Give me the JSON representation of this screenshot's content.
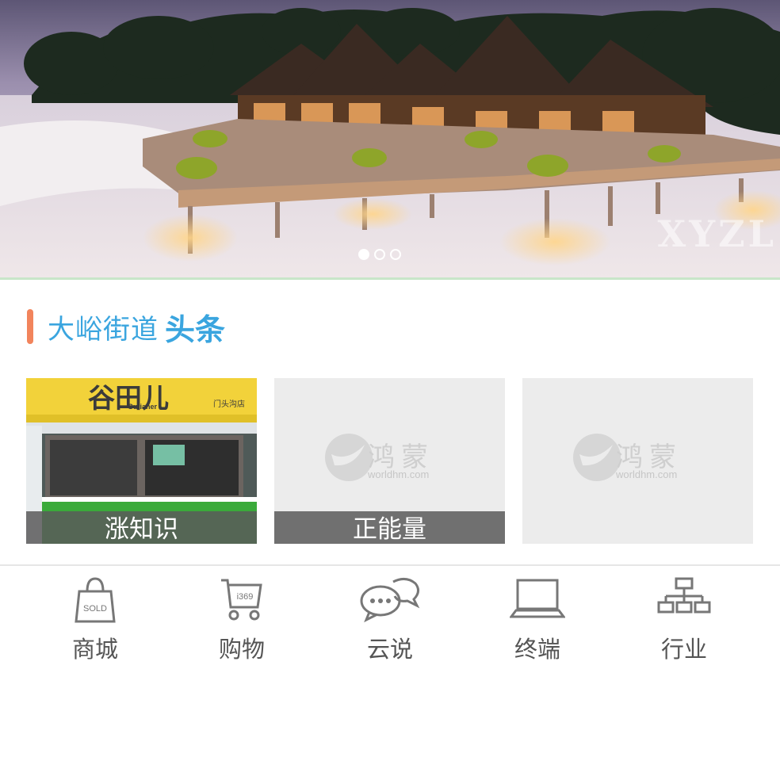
{
  "banner": {
    "watermark": "XYZL",
    "slides_total": 3,
    "active_slide": 1
  },
  "section": {
    "title_main": "大峪街道",
    "title_strong": "头条",
    "accent_color": "#f2845c",
    "title_color": "#3aa5df"
  },
  "cards": [
    {
      "caption": "涨知识",
      "sign_text": "谷田儿",
      "sign_sub": "Gutianer",
      "sign_shop": "门头沟店"
    },
    {
      "caption": "正能量",
      "placeholder_cn": "鸿蒙",
      "placeholder_url": "worldhm.com"
    },
    {
      "caption": "",
      "placeholder_cn": "鸿蒙",
      "placeholder_url": "worldhm.com"
    }
  ],
  "nav": {
    "items": [
      {
        "label": "商城",
        "icon": "shopping-bag-icon",
        "icon_text": "SOLD"
      },
      {
        "label": "购物",
        "icon": "shopping-cart-icon",
        "icon_text": "i369"
      },
      {
        "label": "云说",
        "icon": "chat-bubbles-icon"
      },
      {
        "label": "终端",
        "icon": "laptop-icon"
      },
      {
        "label": "行业",
        "icon": "org-chart-icon"
      }
    ]
  }
}
